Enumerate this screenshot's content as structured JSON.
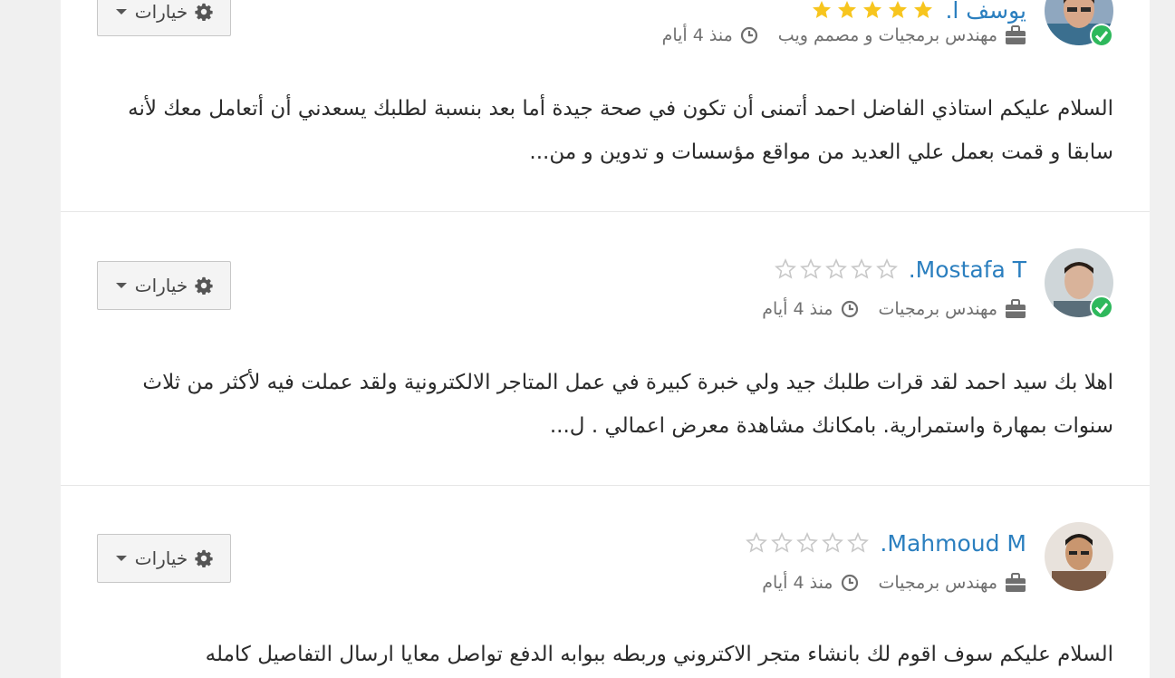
{
  "options_label": "خيارات",
  "colors": {
    "link": "#2b7fbf",
    "star_filled": "#f7c51e",
    "star_empty": "#c8c8c8",
    "verified": "#2eb85c"
  },
  "bids": [
    {
      "name": "يوسف ا.",
      "rating": 5,
      "title": "مهندس برمجيات و مصمم ويب",
      "time": "منذ 4 أيام",
      "text": "السلام عليكم استاذي الفاضل احمد أتمنى أن تكون في صحة جيدة أما بعد بنسبة لطلبك يسعدني أن أتعامل معك لأنه سابقا و قمت بعمل علي العديد من مواقع مؤسسات و تدوين و من..."
    },
    {
      "name": "Mostafa T.",
      "rating": 0,
      "title": "مهندس برمجيات",
      "time": "منذ 4 أيام",
      "text": "اهلا بك سيد احمد لقد قرات طلبك جيد ولي خبرة كبيرة في عمل المتاجر الالكترونية ولقد عملت فيه لأكثر من ثلاث سنوات بمهارة واستمرارية. بامكانك مشاهدة معرض اعمالي . ل..."
    },
    {
      "name": "Mahmoud M.",
      "rating": 0,
      "title": "مهندس برمجيات",
      "time": "منذ 4 أيام",
      "text": "السلام عليكم سوف اقوم لك بانشاء متجر الاكتروني وربطه ببوابه الدفع تواصل معايا ارسال التفاصيل كامله"
    }
  ]
}
